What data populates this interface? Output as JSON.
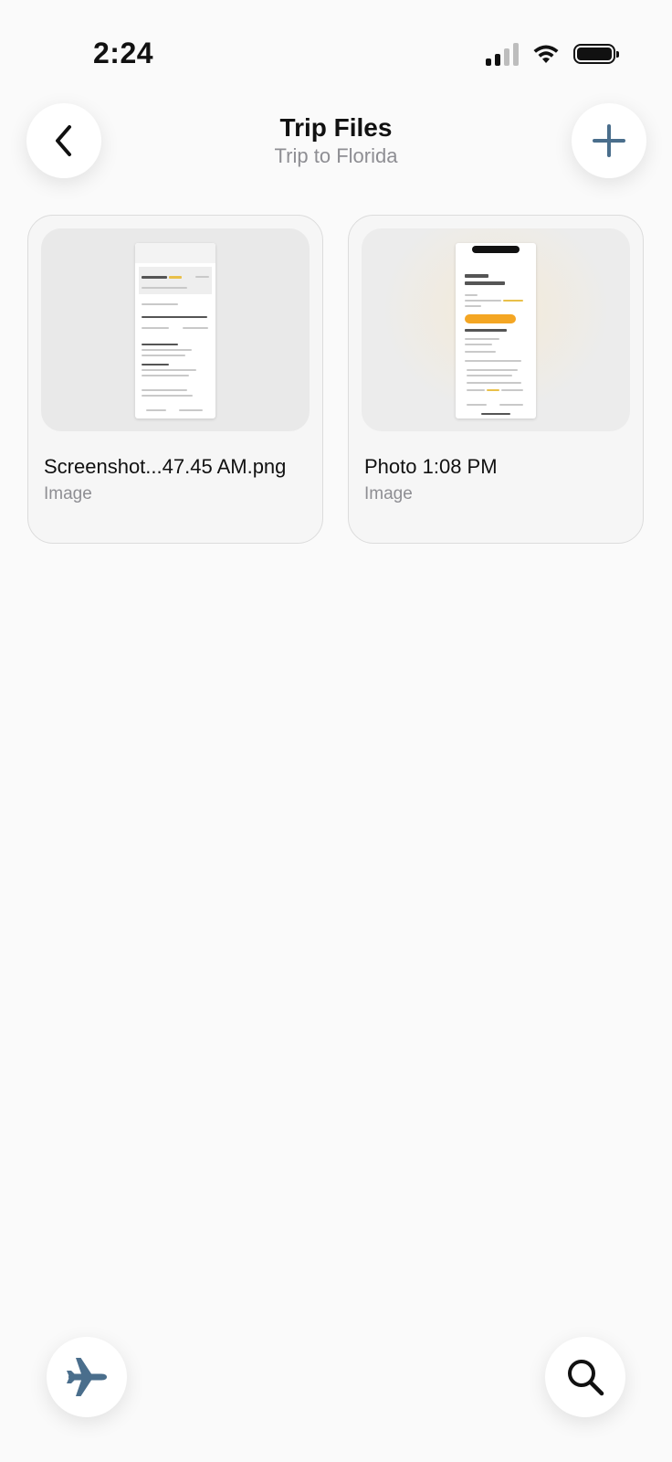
{
  "status_bar": {
    "time": "2:24"
  },
  "header": {
    "title": "Trip Files",
    "subtitle": "Trip to Florida",
    "back_icon": "chevron-left-icon",
    "add_icon": "plus-icon"
  },
  "files": [
    {
      "name": "Screenshot...47.45 AM.png",
      "type": "Image"
    },
    {
      "name": "Photo 1:08 PM",
      "type": "Image"
    }
  ],
  "bottom_bar": {
    "left_icon": "airplane-icon",
    "right_icon": "search-icon"
  },
  "colors": {
    "accent": "#4a6e8c",
    "background": "#fafafa",
    "secondary_text": "#8e8e93"
  }
}
